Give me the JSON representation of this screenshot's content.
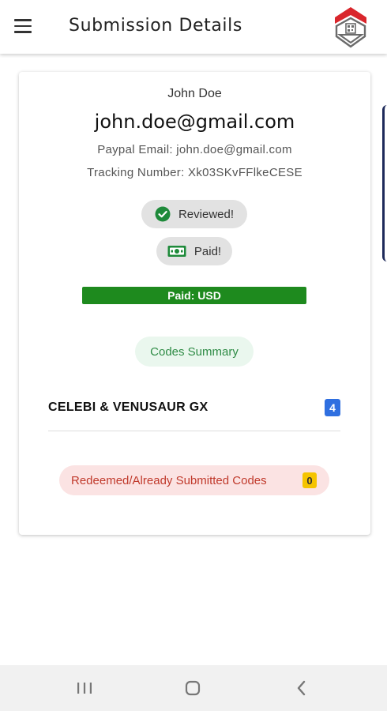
{
  "appbar": {
    "title": "Submission Details",
    "menu_icon": "hamburger-menu-icon",
    "logo_icon": "app-logo-shield-icon",
    "logo_colors": {
      "red": "#d9262c",
      "gray": "#6b6b6b"
    }
  },
  "submission": {
    "name": "John Doe",
    "email": "john.doe@gmail.com",
    "paypal_email": "Paypal Email: john.doe@gmail.com",
    "tracking": "Tracking Number: Xk03SKvFFlkeCESE",
    "reviewed_label": "Reviewed!",
    "reviewed_icon": "check-circle-icon",
    "paid_label": "Paid!",
    "paid_icon": "money-bill-icon",
    "status_bar_label": "Paid: USD",
    "status_color": "#1e8a1e"
  },
  "codes": {
    "summary_label": "Codes Summary",
    "items": [
      {
        "name": "CELEBI & VENUSAUR GX",
        "count": "4"
      }
    ],
    "redeemed_label": "Redeemed/Already Submitted Codes",
    "redeemed_count": "0"
  },
  "navbar": {
    "recents_icon": "recents-icon",
    "home_icon": "home-icon",
    "back_icon": "back-chevron-icon"
  }
}
